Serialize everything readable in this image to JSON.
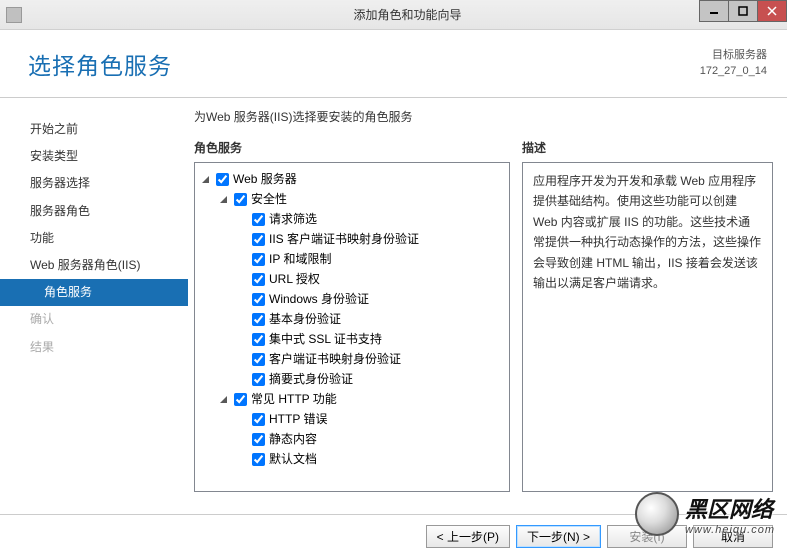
{
  "titlebar": {
    "title": "添加角色和功能向导"
  },
  "header": {
    "page_title": "选择角色服务",
    "dest_label": "目标服务器",
    "dest_value": "172_27_0_14"
  },
  "nav": {
    "items": [
      {
        "label": "开始之前",
        "selected": false,
        "disabled": false,
        "sub": false
      },
      {
        "label": "安装类型",
        "selected": false,
        "disabled": false,
        "sub": false
      },
      {
        "label": "服务器选择",
        "selected": false,
        "disabled": false,
        "sub": false
      },
      {
        "label": "服务器角色",
        "selected": false,
        "disabled": false,
        "sub": false
      },
      {
        "label": "功能",
        "selected": false,
        "disabled": false,
        "sub": false
      },
      {
        "label": "Web 服务器角色(IIS)",
        "selected": false,
        "disabled": false,
        "sub": false
      },
      {
        "label": "角色服务",
        "selected": true,
        "disabled": false,
        "sub": true
      },
      {
        "label": "确认",
        "selected": false,
        "disabled": true,
        "sub": false
      },
      {
        "label": "结果",
        "selected": false,
        "disabled": true,
        "sub": false
      }
    ]
  },
  "main": {
    "intro": "为Web 服务器(IIS)选择要安装的角色服务",
    "left_head": "角色服务",
    "right_head": "描述",
    "description": "应用程序开发为开发和承载 Web 应用程序提供基础结构。使用这些功能可以创建 Web 内容或扩展 IIS 的功能。这些技术通常提供一种执行动态操作的方法，这些操作会导致创建 HTML 输出，IIS 接着会发送该输出以满足客户端请求。"
  },
  "tree": [
    {
      "indent": 0,
      "toggle": "open",
      "checked": true,
      "label": "Web 服务器"
    },
    {
      "indent": 1,
      "toggle": "open",
      "checked": true,
      "label": "安全性"
    },
    {
      "indent": 2,
      "toggle": "",
      "checked": true,
      "label": "请求筛选"
    },
    {
      "indent": 2,
      "toggle": "",
      "checked": true,
      "label": "IIS 客户端证书映射身份验证"
    },
    {
      "indent": 2,
      "toggle": "",
      "checked": true,
      "label": "IP 和域限制"
    },
    {
      "indent": 2,
      "toggle": "",
      "checked": true,
      "label": "URL 授权"
    },
    {
      "indent": 2,
      "toggle": "",
      "checked": true,
      "label": "Windows 身份验证"
    },
    {
      "indent": 2,
      "toggle": "",
      "checked": true,
      "label": "基本身份验证"
    },
    {
      "indent": 2,
      "toggle": "",
      "checked": true,
      "label": "集中式 SSL 证书支持"
    },
    {
      "indent": 2,
      "toggle": "",
      "checked": true,
      "label": "客户端证书映射身份验证"
    },
    {
      "indent": 2,
      "toggle": "",
      "checked": true,
      "label": "摘要式身份验证"
    },
    {
      "indent": 1,
      "toggle": "open",
      "checked": true,
      "label": "常见 HTTP 功能"
    },
    {
      "indent": 2,
      "toggle": "",
      "checked": true,
      "label": "HTTP 错误"
    },
    {
      "indent": 2,
      "toggle": "",
      "checked": true,
      "label": "静态内容"
    },
    {
      "indent": 2,
      "toggle": "",
      "checked": true,
      "label": "默认文档"
    }
  ],
  "footer": {
    "prev": "< 上一步(P)",
    "next": "下一步(N) >",
    "install": "安装(I)",
    "cancel": "取消"
  },
  "watermark": {
    "main": "黑区网络",
    "sub": "www.heiqu.com"
  }
}
